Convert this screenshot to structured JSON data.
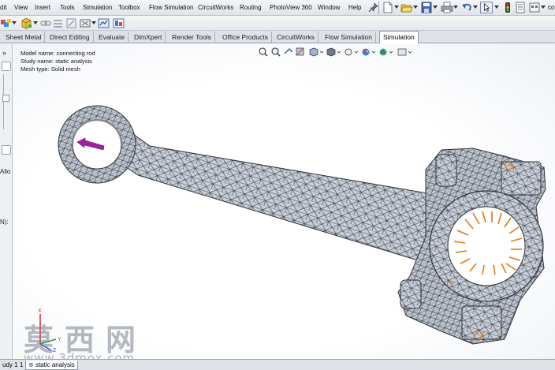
{
  "menu": {
    "items": [
      "dit",
      "View",
      "Insert",
      "Tools",
      "Simulation",
      "Toolbox",
      "Flow Simulation",
      "CircuitWorks",
      "Routing",
      "PhotoView 360",
      "Window",
      "Help"
    ],
    "right_label": "co"
  },
  "tabs": {
    "items": [
      "Sheet Metal",
      "Direct Editing",
      "Evaluate",
      "DimXpert",
      "Render Tools",
      "Office Products",
      "CircuitWorks",
      "Flow Simulation",
      "Simulation"
    ],
    "active": "Simulation"
  },
  "left_panel": {
    "chevron": "»",
    "label_alc": "Allo",
    "label_n": "N):"
  },
  "viewport": {
    "model_name": "Model name: connecting rod",
    "study_name": "Study name: static analysis",
    "mesh_type": "Mesh type: Solid mesh",
    "triad_labels": {
      "x": "X",
      "y": "Y",
      "z": "Z"
    }
  },
  "bottom": {
    "study_tab": "udy 1",
    "arrow": "1",
    "active_tab": "static analysis"
  },
  "watermark": {
    "cn": "莫西网",
    "url": "www.3dmox.com"
  },
  "colors": {
    "mesh_fill": "#c9cfd8",
    "mesh_line": "#3a3f48",
    "fixture": "#a020a0",
    "load": "#e07a10"
  }
}
